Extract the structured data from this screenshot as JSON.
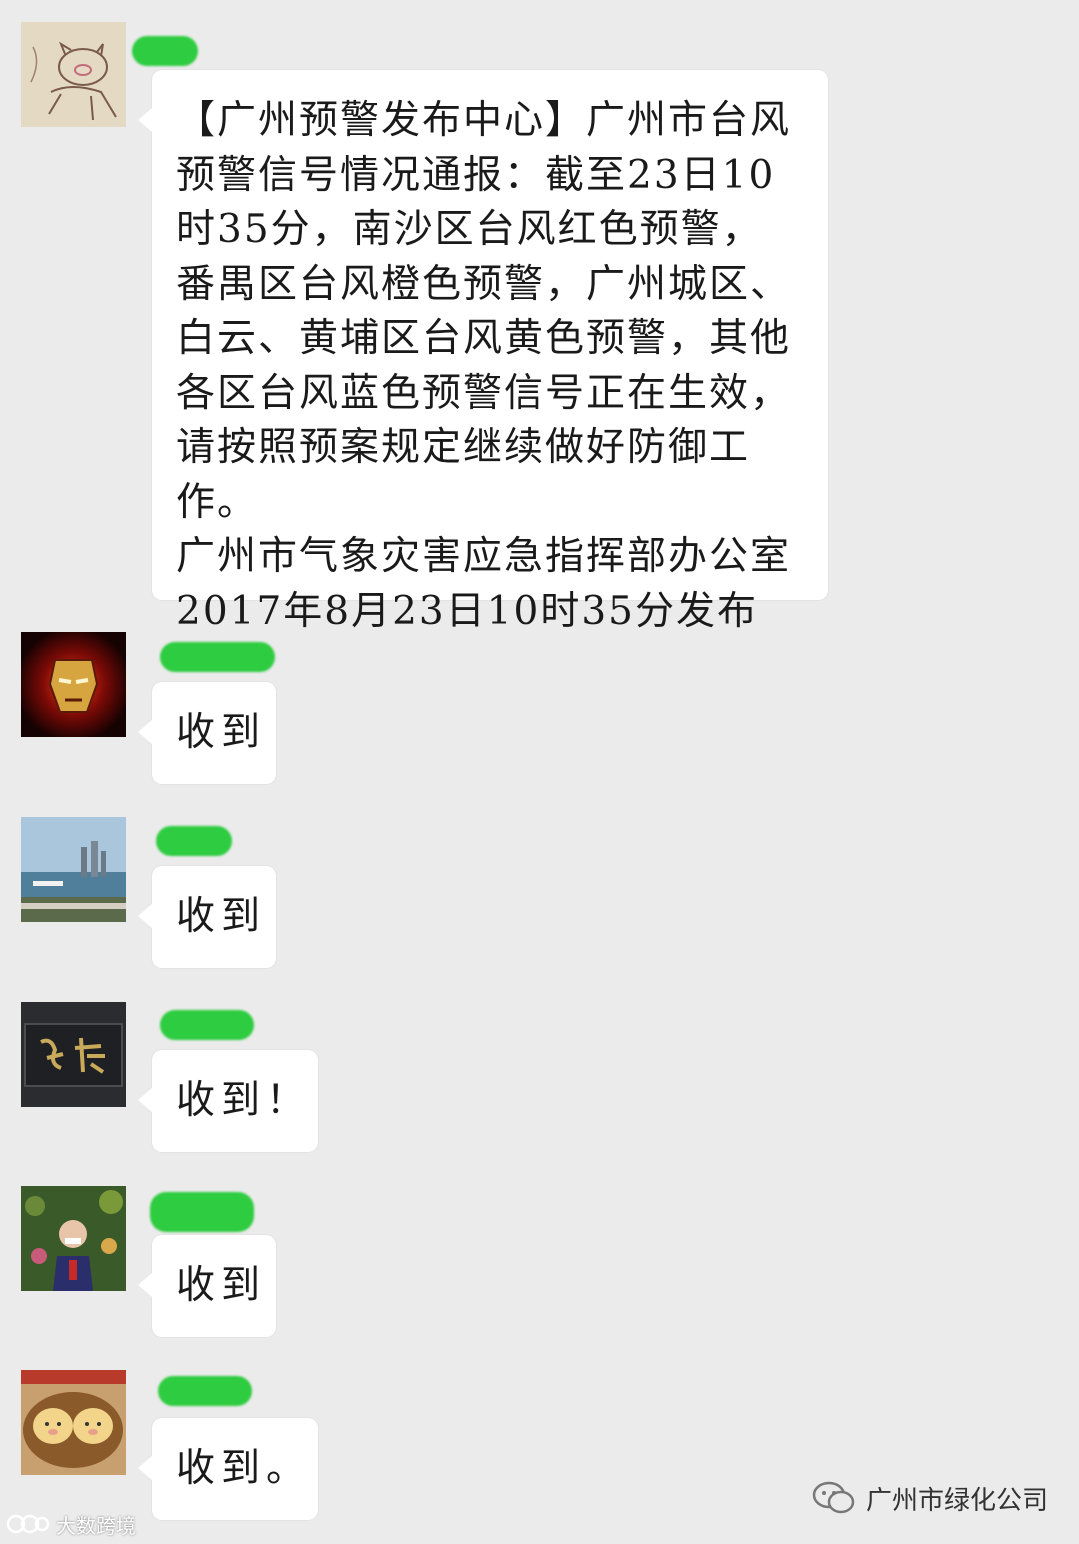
{
  "chat": {
    "messages": [
      {
        "id": "m1",
        "avatar": "pig-sketch-avatar",
        "text": "【广州预警发布中心】广州市台风预警信号情况通报：截至23日10时35分，南沙区台风红色预警，番禺区台风橙色预警，广州城区、白云、黄埔区台风黄色预警，其他各区台风蓝色预警信号正在生效，请按照预案规定继续做好防御工作。\n广州市气象灾害应急指挥部办公室2017年8月23日10时35分发布"
      },
      {
        "id": "m2",
        "avatar": "iron-man-avatar",
        "text": "收到"
      },
      {
        "id": "m3",
        "avatar": "harbor-city-avatar",
        "text": "收到"
      },
      {
        "id": "m4",
        "avatar": "calligraphy-plaque-avatar",
        "text": "收到！"
      },
      {
        "id": "m5",
        "avatar": "child-photo-avatar",
        "text": "收到"
      },
      {
        "id": "m6",
        "avatar": "pig-buns-avatar",
        "text": "收到。"
      }
    ]
  },
  "watermark": {
    "left_text": "大数跨境",
    "right_text": "广州市绿化公司"
  },
  "colors": {
    "background": "#ebebeb",
    "bubble": "#ffffff",
    "name_redaction": "#2ecc40",
    "text": "#1a1a1a"
  }
}
